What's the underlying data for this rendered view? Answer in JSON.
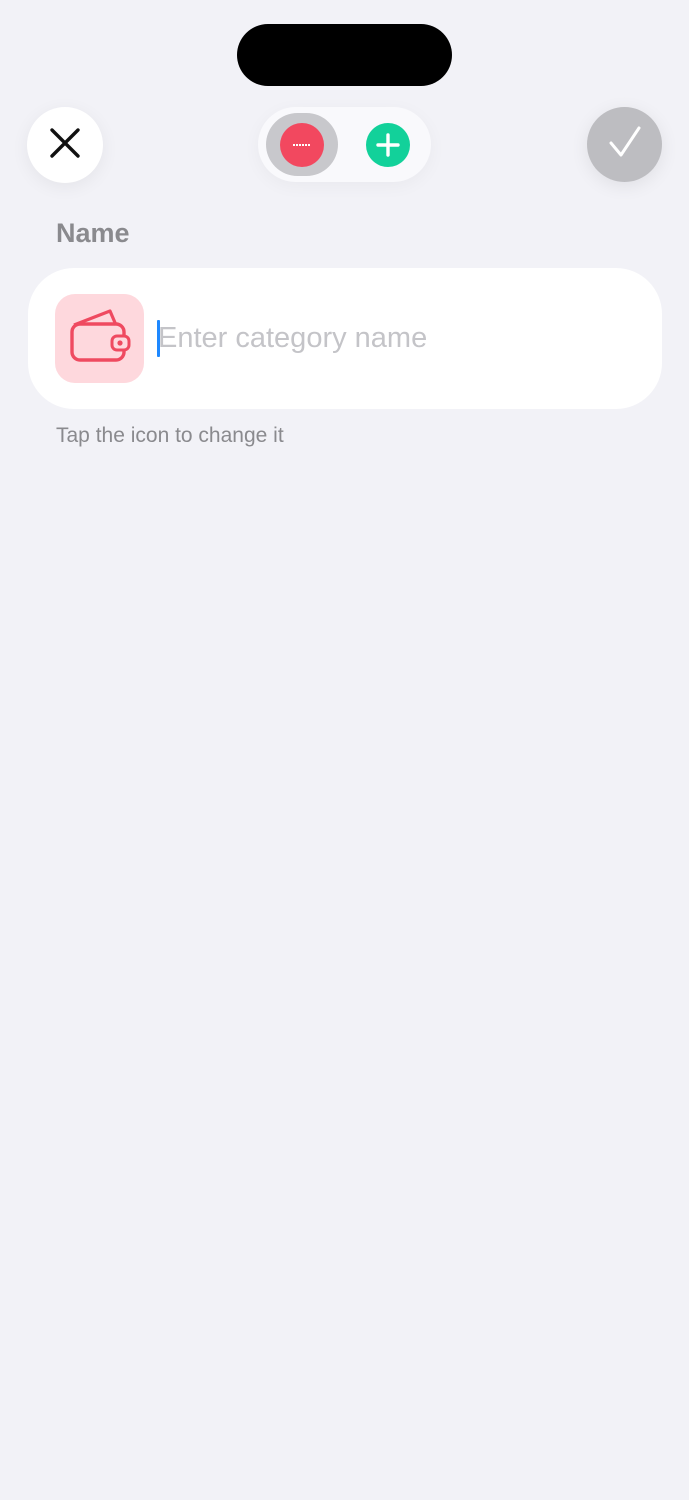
{
  "header": {
    "close_icon": "close-icon",
    "confirm_icon": "checkmark-icon",
    "type_toggle": {
      "options": [
        {
          "id": "expense",
          "icon": "minus-circle-icon",
          "color": "#f2485f",
          "selected": true
        },
        {
          "id": "income",
          "icon": "plus-circle-icon",
          "color": "#12d19a",
          "selected": false
        }
      ]
    }
  },
  "form": {
    "section_label": "Name",
    "category_icon": "wallet-icon",
    "category_icon_color": "#ef4a60",
    "category_icon_bg": "#fed8dd",
    "name_value": "",
    "name_placeholder": "Enter category name",
    "hint": "Tap the icon to change it"
  },
  "colors": {
    "background": "#f2f2f7",
    "accent_caret": "#1e88ff"
  }
}
